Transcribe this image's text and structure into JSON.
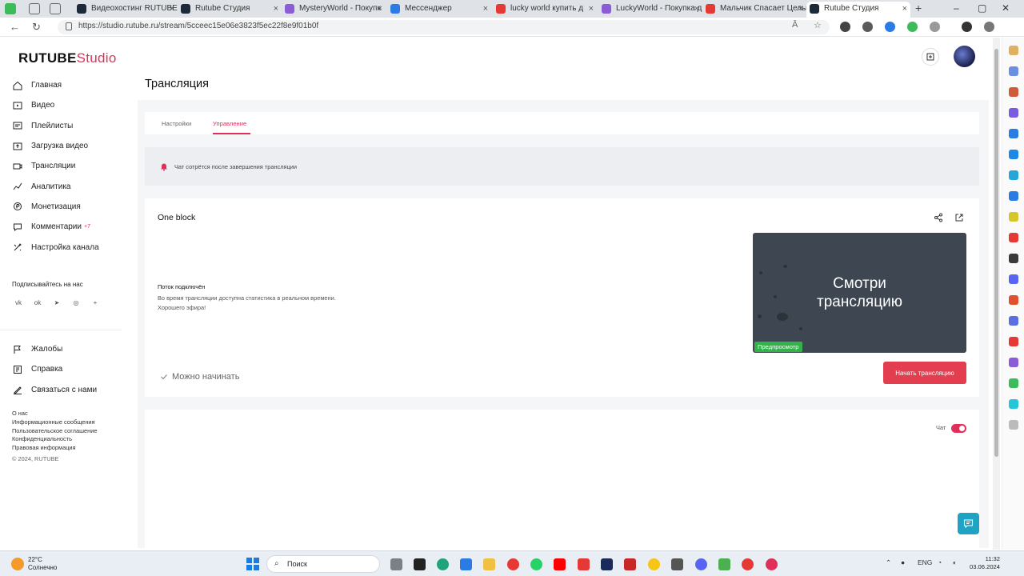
{
  "browser": {
    "tabs": [
      {
        "label": "Видеохостинг RUTUBE",
        "color": "#1e2a3a"
      },
      {
        "label": "Rutube Студия",
        "color": "#1e2a3a"
      },
      {
        "label": "MysteryWorld - Покупк",
        "color": "#8a5cd6"
      },
      {
        "label": "Мессенджер",
        "color": "#2b7be5"
      },
      {
        "label": "lucky world купить д",
        "color": "#e53935"
      },
      {
        "label": "LuckyWorld - Покупка д",
        "color": "#8a5cd6"
      },
      {
        "label": "Мальчик Спасает Целы",
        "color": "#e53935"
      },
      {
        "label": "Rutube Студия",
        "color": "#1e2a3a"
      }
    ],
    "url": "https://studio.rutube.ru/stream/5cceec15e06e3823f5ec22f8e9f01b0f"
  },
  "logo": {
    "part1": "RUTUBE",
    "part2": "Studio"
  },
  "sidebar": {
    "items": [
      {
        "label": "Главная",
        "icon": "home-icon"
      },
      {
        "label": "Видео",
        "icon": "video-icon"
      },
      {
        "label": "Плейлисты",
        "icon": "playlist-icon"
      },
      {
        "label": "Загрузка видео",
        "icon": "upload-icon"
      },
      {
        "label": "Трансляции",
        "icon": "broadcast-icon"
      },
      {
        "label": "Аналитика",
        "icon": "analytics-icon"
      },
      {
        "label": "Монетизация",
        "icon": "monetization-icon"
      },
      {
        "label": "Комментарии",
        "icon": "comments-icon",
        "badge": "+7"
      },
      {
        "label": "Настройка канала",
        "icon": "channel-settings-icon"
      }
    ],
    "subscribe_title": "Подписывайтесь на нас",
    "social": [
      "vk-icon",
      "ok-icon",
      "telegram-icon",
      "viber-icon",
      "plus-icon"
    ],
    "items2": [
      {
        "label": "Жалобы",
        "icon": "flag-icon"
      },
      {
        "label": "Справка",
        "icon": "help-icon"
      },
      {
        "label": "Связаться с нами",
        "icon": "contact-icon"
      }
    ],
    "footer": [
      "О нас",
      "Информационные сообщения",
      "Пользовательское соглашение",
      "Конфиденциальность",
      "Правовая информация"
    ],
    "copyright": "© 2024, RUTUBE"
  },
  "page": {
    "title": "Трансляция",
    "tabs": [
      "Настройки",
      "Управление"
    ],
    "active_tab": "Управление",
    "notice": "Чат сотрётся после завершения трансляции",
    "stream": {
      "name": "One block",
      "status_title": "Поток подключён",
      "status_line1": "Во время трансляции доступна статистика в реальном времени.",
      "status_line2": "Хорошего эфира!",
      "ready": "Можно начинать",
      "preview_line1": "Смотри",
      "preview_line2": "трансляцию",
      "preview_label": "Предпросмотр",
      "start_button": "Начать трансляцию"
    },
    "chat": {
      "label": "Чат",
      "enabled": true
    }
  },
  "taskbar": {
    "weather_temp": "22°C",
    "weather_desc": "Солнечно",
    "search": "Поиск",
    "lang": "ENG",
    "time": "11:32",
    "date": "03.06.2024"
  },
  "colors": {
    "accent": "#e0305a",
    "start_button": "#e33d50",
    "preview_bg": "#3d4651",
    "preview_label": "#33b24b"
  }
}
